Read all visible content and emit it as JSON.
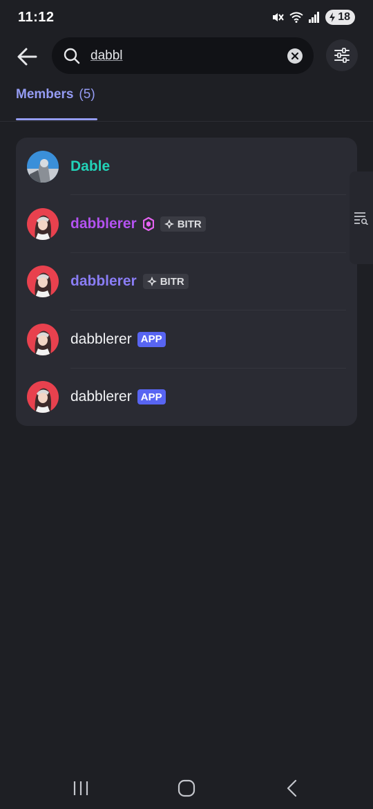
{
  "status_bar": {
    "time": "11:12",
    "battery": "18"
  },
  "search": {
    "value": "dabbl"
  },
  "tabs": {
    "members_label": "Members",
    "members_count": "(5)"
  },
  "members": [
    {
      "name": "Dable",
      "tags": []
    },
    {
      "name": "dabblerer",
      "tags": [
        "BITR"
      ]
    },
    {
      "name": "dabblerer",
      "tags": [
        "BITR"
      ]
    },
    {
      "name": "dabblerer",
      "tags": [
        "APP"
      ]
    },
    {
      "name": "dabblerer",
      "tags": [
        "APP"
      ]
    }
  ],
  "colors": {
    "background": "#1e1f24",
    "card": "#2a2b33",
    "accent": "#959cf4",
    "app_tag": "#5865f2",
    "name_teal": "#22d3b8",
    "name_purple": "#b352f0",
    "name_blurple": "#8a7df5"
  },
  "icons": [
    "back-arrow-icon",
    "search-icon",
    "clear-icon",
    "filter-sliders-icon",
    "member-list-search-icon",
    "recent-apps-icon",
    "home-icon",
    "nav-back-icon"
  ]
}
